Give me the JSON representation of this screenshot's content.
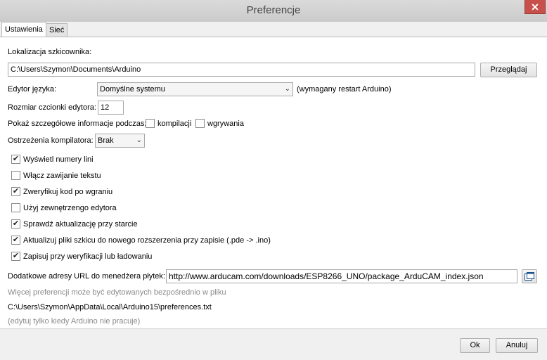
{
  "window": {
    "title": "Preferencje",
    "close_glyph": "✕"
  },
  "tabs": [
    {
      "label": "Ustawienia",
      "active": true
    },
    {
      "label": "Sieć",
      "active": false
    }
  ],
  "sketchbook": {
    "label": "Lokalizacja szkicownika:",
    "value": "C:\\Users\\Szymon\\Documents\\Arduino",
    "browse_label": "Przeglądaj"
  },
  "language": {
    "label": "Edytor języka:",
    "value": "Domyślne systemu",
    "note": "(wymagany restart Arduino)"
  },
  "font_size": {
    "label": "Rozmiar czcionki edytora:",
    "value": "12"
  },
  "verbose": {
    "label": "Pokaż szczegółowe informacje podczas:",
    "compile_label": "kompilacji",
    "compile_checked": false,
    "upload_label": "wgrywania",
    "upload_checked": false
  },
  "warnings": {
    "label": "Ostrzeżenia kompilatora:",
    "value": "Brak"
  },
  "checkboxes": [
    {
      "label": "Wyświetl numery lini",
      "checked": true
    },
    {
      "label": "Włącz zawijanie tekstu",
      "checked": false
    },
    {
      "label": "Zweryfikuj kod po wgraniu",
      "checked": true
    },
    {
      "label": "Użyj zewnętrzengo edytora",
      "checked": false
    },
    {
      "label": "Sprawdź aktualizację przy starcie",
      "checked": true
    },
    {
      "label": "Aktualizuj pliki szkicu do nowego rozszerzenia przy zapisie (.pde -> .ino)",
      "checked": true
    },
    {
      "label": "Zapisuj przy weryfikacji lub ładowaniu",
      "checked": true
    }
  ],
  "boards_url": {
    "label": "Dodatkowe adresy URL do menedżera płytek:",
    "value": "http://www.arducam.com/downloads/ESP8266_UNO/package_ArduCAM_index.json"
  },
  "info": {
    "more_prefs": "Więcej preferencji może być edytowanych bezpośrednio w pliku",
    "path": "C:\\Users\\Szymon\\AppData\\Local\\Arduino15\\preferences.txt",
    "edit_note": "(edytuj tylko kiedy Arduino nie pracuje)"
  },
  "footer": {
    "ok_label": "Ok",
    "cancel_label": "Anuluj"
  },
  "check_glyph": "✔",
  "dropdown_glyph": "⌄"
}
